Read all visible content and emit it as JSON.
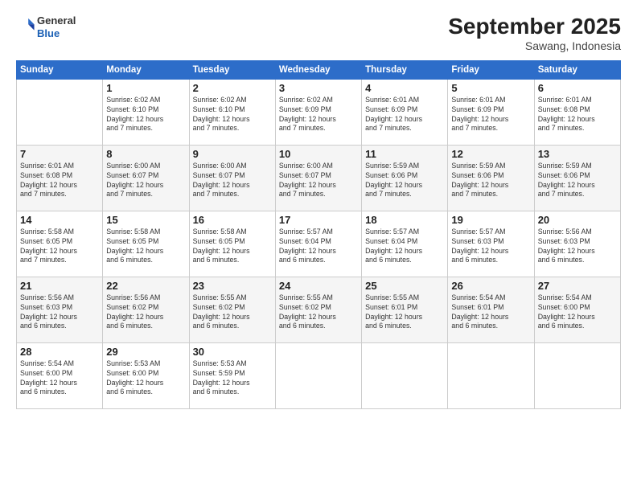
{
  "header": {
    "logo_line1": "General",
    "logo_line2": "Blue",
    "month": "September 2025",
    "location": "Sawang, Indonesia"
  },
  "weekdays": [
    "Sunday",
    "Monday",
    "Tuesday",
    "Wednesday",
    "Thursday",
    "Friday",
    "Saturday"
  ],
  "weeks": [
    [
      {
        "day": "",
        "info": ""
      },
      {
        "day": "1",
        "info": "Sunrise: 6:02 AM\nSunset: 6:10 PM\nDaylight: 12 hours\nand 7 minutes."
      },
      {
        "day": "2",
        "info": "Sunrise: 6:02 AM\nSunset: 6:10 PM\nDaylight: 12 hours\nand 7 minutes."
      },
      {
        "day": "3",
        "info": "Sunrise: 6:02 AM\nSunset: 6:09 PM\nDaylight: 12 hours\nand 7 minutes."
      },
      {
        "day": "4",
        "info": "Sunrise: 6:01 AM\nSunset: 6:09 PM\nDaylight: 12 hours\nand 7 minutes."
      },
      {
        "day": "5",
        "info": "Sunrise: 6:01 AM\nSunset: 6:09 PM\nDaylight: 12 hours\nand 7 minutes."
      },
      {
        "day": "6",
        "info": "Sunrise: 6:01 AM\nSunset: 6:08 PM\nDaylight: 12 hours\nand 7 minutes."
      }
    ],
    [
      {
        "day": "7",
        "info": "Sunrise: 6:01 AM\nSunset: 6:08 PM\nDaylight: 12 hours\nand 7 minutes."
      },
      {
        "day": "8",
        "info": "Sunrise: 6:00 AM\nSunset: 6:07 PM\nDaylight: 12 hours\nand 7 minutes."
      },
      {
        "day": "9",
        "info": "Sunrise: 6:00 AM\nSunset: 6:07 PM\nDaylight: 12 hours\nand 7 minutes."
      },
      {
        "day": "10",
        "info": "Sunrise: 6:00 AM\nSunset: 6:07 PM\nDaylight: 12 hours\nand 7 minutes."
      },
      {
        "day": "11",
        "info": "Sunrise: 5:59 AM\nSunset: 6:06 PM\nDaylight: 12 hours\nand 7 minutes."
      },
      {
        "day": "12",
        "info": "Sunrise: 5:59 AM\nSunset: 6:06 PM\nDaylight: 12 hours\nand 7 minutes."
      },
      {
        "day": "13",
        "info": "Sunrise: 5:59 AM\nSunset: 6:06 PM\nDaylight: 12 hours\nand 7 minutes."
      }
    ],
    [
      {
        "day": "14",
        "info": "Sunrise: 5:58 AM\nSunset: 6:05 PM\nDaylight: 12 hours\nand 7 minutes."
      },
      {
        "day": "15",
        "info": "Sunrise: 5:58 AM\nSunset: 6:05 PM\nDaylight: 12 hours\nand 6 minutes."
      },
      {
        "day": "16",
        "info": "Sunrise: 5:58 AM\nSunset: 6:05 PM\nDaylight: 12 hours\nand 6 minutes."
      },
      {
        "day": "17",
        "info": "Sunrise: 5:57 AM\nSunset: 6:04 PM\nDaylight: 12 hours\nand 6 minutes."
      },
      {
        "day": "18",
        "info": "Sunrise: 5:57 AM\nSunset: 6:04 PM\nDaylight: 12 hours\nand 6 minutes."
      },
      {
        "day": "19",
        "info": "Sunrise: 5:57 AM\nSunset: 6:03 PM\nDaylight: 12 hours\nand 6 minutes."
      },
      {
        "day": "20",
        "info": "Sunrise: 5:56 AM\nSunset: 6:03 PM\nDaylight: 12 hours\nand 6 minutes."
      }
    ],
    [
      {
        "day": "21",
        "info": "Sunrise: 5:56 AM\nSunset: 6:03 PM\nDaylight: 12 hours\nand 6 minutes."
      },
      {
        "day": "22",
        "info": "Sunrise: 5:56 AM\nSunset: 6:02 PM\nDaylight: 12 hours\nand 6 minutes."
      },
      {
        "day": "23",
        "info": "Sunrise: 5:55 AM\nSunset: 6:02 PM\nDaylight: 12 hours\nand 6 minutes."
      },
      {
        "day": "24",
        "info": "Sunrise: 5:55 AM\nSunset: 6:02 PM\nDaylight: 12 hours\nand 6 minutes."
      },
      {
        "day": "25",
        "info": "Sunrise: 5:55 AM\nSunset: 6:01 PM\nDaylight: 12 hours\nand 6 minutes."
      },
      {
        "day": "26",
        "info": "Sunrise: 5:54 AM\nSunset: 6:01 PM\nDaylight: 12 hours\nand 6 minutes."
      },
      {
        "day": "27",
        "info": "Sunrise: 5:54 AM\nSunset: 6:00 PM\nDaylight: 12 hours\nand 6 minutes."
      }
    ],
    [
      {
        "day": "28",
        "info": "Sunrise: 5:54 AM\nSunset: 6:00 PM\nDaylight: 12 hours\nand 6 minutes."
      },
      {
        "day": "29",
        "info": "Sunrise: 5:53 AM\nSunset: 6:00 PM\nDaylight: 12 hours\nand 6 minutes."
      },
      {
        "day": "30",
        "info": "Sunrise: 5:53 AM\nSunset: 5:59 PM\nDaylight: 12 hours\nand 6 minutes."
      },
      {
        "day": "",
        "info": ""
      },
      {
        "day": "",
        "info": ""
      },
      {
        "day": "",
        "info": ""
      },
      {
        "day": "",
        "info": ""
      }
    ]
  ]
}
